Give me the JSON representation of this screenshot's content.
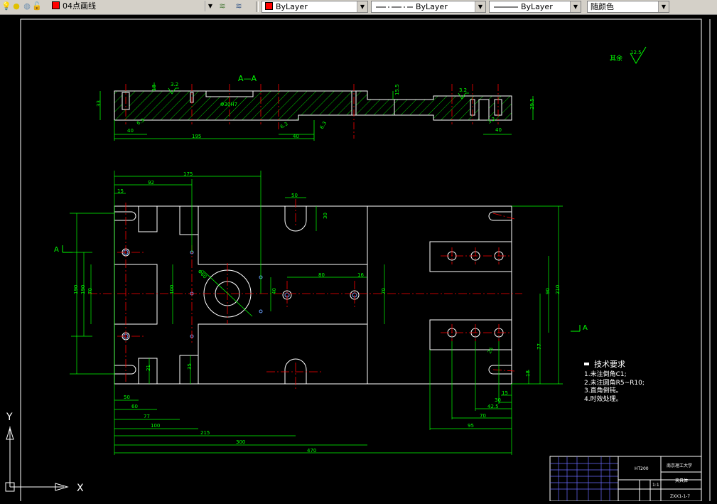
{
  "toolbar": {
    "layer_name": "04点画线",
    "color": {
      "label": "ByLayer",
      "swatch": "#ff0000"
    },
    "linetype": {
      "label": "ByLayer"
    },
    "lineweight": {
      "label": "ByLayer"
    },
    "plotstyle": {
      "label": "随颜色"
    }
  },
  "drawing": {
    "section_title": "A—A",
    "roughness_note_label": "其余",
    "roughness_value": "12.5",
    "section_marker_label": "A",
    "section_marker_label_2": "A",
    "top_dims": {
      "height_left": "33",
      "d_40_left": "40",
      "d_195": "195",
      "d_40_mid": "40",
      "hole_note": "Φ30H7",
      "d_15_5": "15.5",
      "d_29_5": "29.5",
      "d_40_right": "40",
      "rough_a": "3.2",
      "rough_b": "6.3",
      "rough_c": "6.3",
      "rough_d": "3.2",
      "rough_e": "6.3",
      "rough_f": "3.2",
      "d_18": "18"
    },
    "plan_dims": {
      "d_175": "175",
      "d_92": "92",
      "d_15": "15",
      "d_50_top": "50",
      "d_30": "30",
      "d_80": "80",
      "d_16": "16",
      "d_190_a": "190",
      "d_190_b": "190",
      "d_70": "70",
      "d_100": "100",
      "d_40": "40",
      "d_r_label": "Φ60",
      "d_70_mid": "70",
      "d_90": "90",
      "d_210": "210",
      "d_77_right": "77",
      "d_18_right": "18",
      "d_21": "21",
      "d_35": "35",
      "d_26": "26",
      "b_50": "50",
      "b_60": "60",
      "b_77": "77",
      "b_100": "100",
      "b_215": "215",
      "b_300": "300",
      "b_470": "470",
      "r_15": "15",
      "r_30": "30",
      "r_42_5": "42.5",
      "r_70": "70",
      "r_95": "95"
    },
    "tech_requirements": {
      "title": "技术要求",
      "items": [
        "1.未注倒角C1;",
        "2.未注圆角R5~R10;",
        "3.直角倒钝。",
        "4.时效处理。"
      ]
    },
    "title_block": {
      "university": "南京理工大学",
      "part_name": "夹具体",
      "material": "HT200",
      "scale": "1:1",
      "drawing_no": "ZXX1-1-7"
    },
    "ucs": {
      "x_label": "X",
      "y_label": "Y"
    }
  }
}
